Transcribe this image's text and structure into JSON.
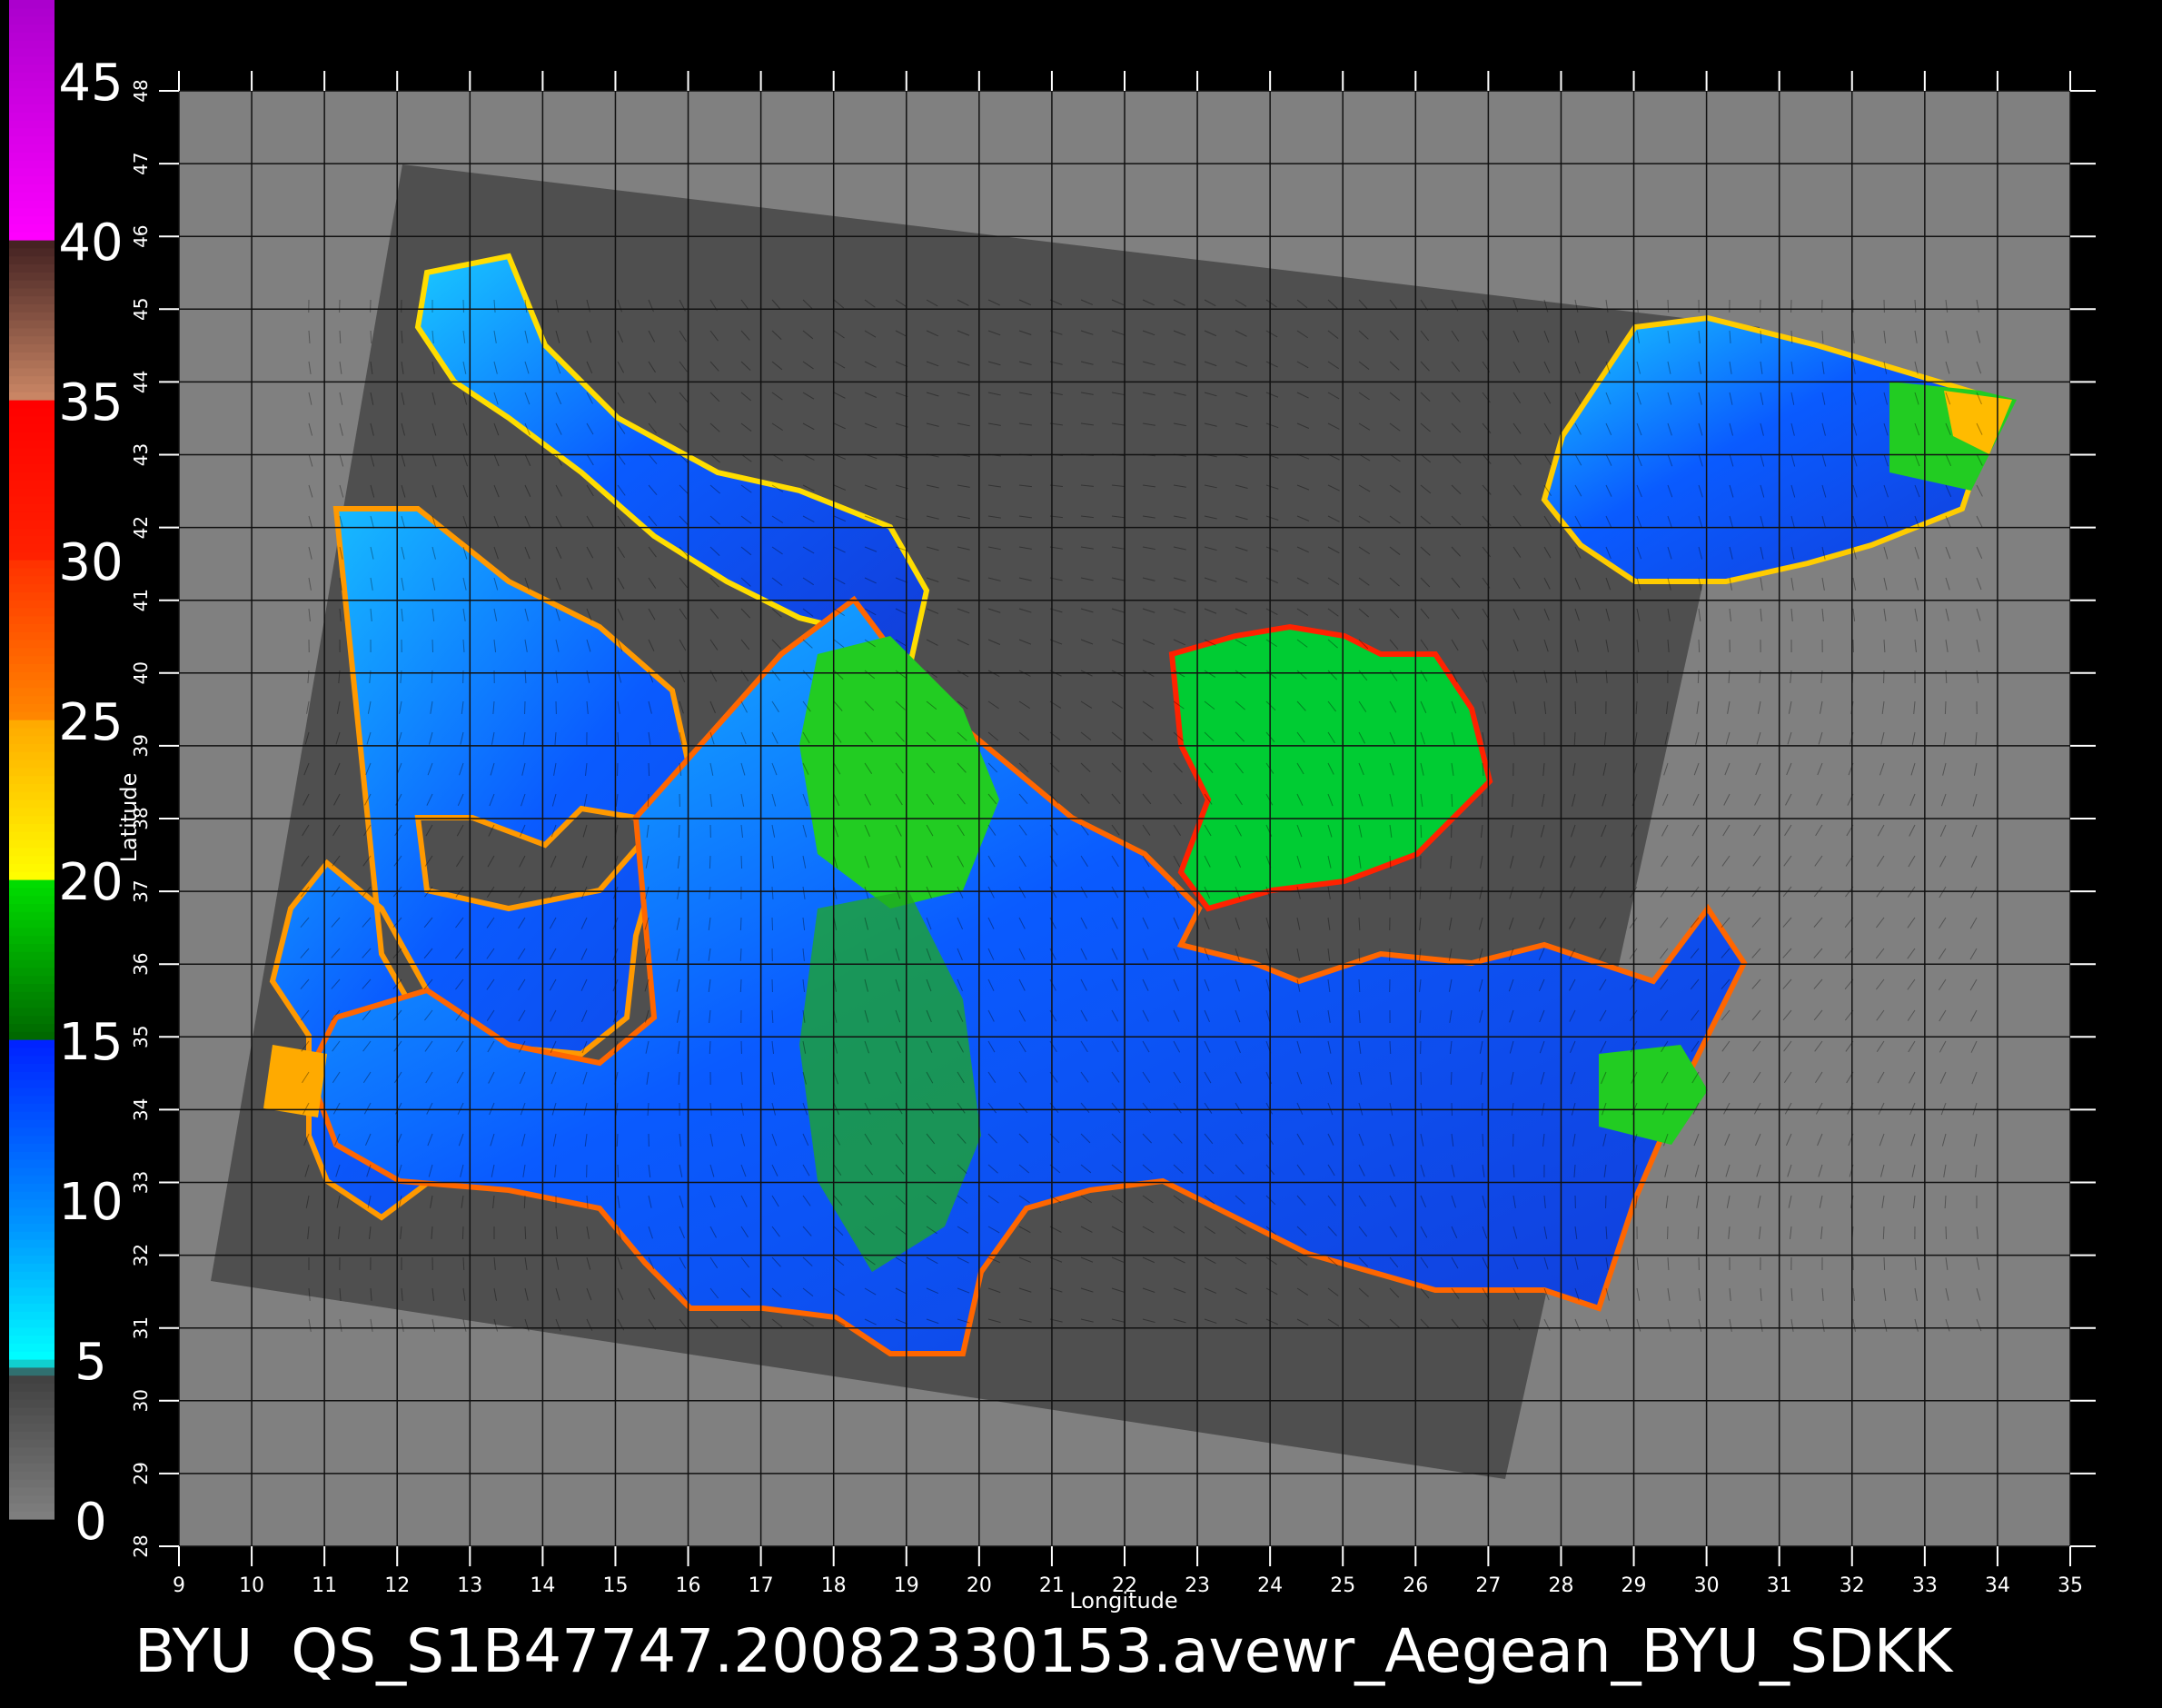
{
  "title": "BYU  QS_S1B47747.20082330153.avewr_Aegean_BYU_SDKK",
  "axes": {
    "xlabel": "Longitude",
    "ylabel": "Latitude",
    "xlim": [
      9,
      35
    ],
    "ylim": [
      28,
      48
    ],
    "xticks": [
      "9",
      "10",
      "11",
      "12",
      "13",
      "14",
      "15",
      "16",
      "17",
      "18",
      "19",
      "20",
      "21",
      "22",
      "23",
      "24",
      "25",
      "26",
      "27",
      "28",
      "29",
      "30",
      "31",
      "32",
      "33",
      "34",
      "35"
    ],
    "yticks": [
      "28",
      "29",
      "30",
      "31",
      "32",
      "33",
      "34",
      "35",
      "36",
      "37",
      "38",
      "39",
      "40",
      "41",
      "42",
      "43",
      "44",
      "45",
      "46",
      "47",
      "48"
    ]
  },
  "colorbar": {
    "labels": [
      "0",
      "5",
      "10",
      "15",
      "20",
      "25",
      "30",
      "35",
      "40",
      "45"
    ],
    "range": [
      0,
      47.5
    ],
    "stops": [
      {
        "v": 0,
        "c": "#808080"
      },
      {
        "v": 4.5,
        "c": "#404040"
      },
      {
        "v": 5,
        "c": "#00ffff"
      },
      {
        "v": 9,
        "c": "#0099ff"
      },
      {
        "v": 14.9,
        "c": "#0022ff"
      },
      {
        "v": 15,
        "c": "#006600"
      },
      {
        "v": 19.9,
        "c": "#00dd00"
      },
      {
        "v": 20,
        "c": "#ffff00"
      },
      {
        "v": 24.9,
        "c": "#ffaa00"
      },
      {
        "v": 25,
        "c": "#ff8800"
      },
      {
        "v": 29.9,
        "c": "#ff3300"
      },
      {
        "v": 30,
        "c": "#ff2200"
      },
      {
        "v": 34.9,
        "c": "#ff0000"
      },
      {
        "v": 35,
        "c": "#cc8866"
      },
      {
        "v": 39.9,
        "c": "#442222"
      },
      {
        "v": 40,
        "c": "#ff00ff"
      },
      {
        "v": 47.5,
        "c": "#aa00cc"
      }
    ]
  },
  "colors": {
    "background": "#000000",
    "land": "#808080",
    "swath": "#4f4f4f",
    "grid": "#111111",
    "text": "#ffffff"
  }
}
